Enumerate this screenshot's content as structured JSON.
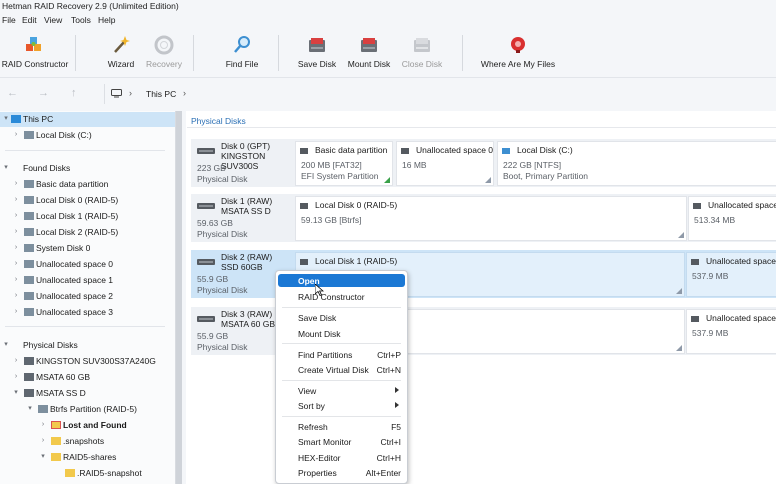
{
  "window": {
    "title": "Hetman RAID Recovery 2.9 (Unlimited Edition)"
  },
  "menu": [
    "File",
    "Edit",
    "View",
    "Tools",
    "Help"
  ],
  "toolbar": {
    "raid_constructor": "RAID Constructor",
    "wizard": "Wizard",
    "recovery": "Recovery",
    "find_file": "Find File",
    "save_disk": "Save Disk",
    "mount_disk": "Mount Disk",
    "close_disk": "Close Disk",
    "where_are_my_files": "Where Are My Files"
  },
  "breadcrumb": {
    "location": "This PC"
  },
  "tree": {
    "this_pc": "This PC",
    "local_disk_c": "Local Disk (C:)",
    "found_disks": "Found Disks",
    "found_items": [
      "Basic data partition",
      "Local Disk 0 (RAID-5)",
      "Local Disk 1 (RAID-5)",
      "Local Disk 2 (RAID-5)",
      "System Disk 0",
      "Unallocated space 0",
      "Unallocated space 1",
      "Unallocated space 2",
      "Unallocated space 3"
    ],
    "physical_disks": "Physical Disks",
    "physical_items": [
      "KINGSTON SUV300S37A240G",
      "MSATA 60 GB",
      "MSATA SS D"
    ],
    "btrfs": "Btrfs Partition (RAID-5)",
    "lost_and_found": "Lost and Found",
    "snapshots": ".snapshots",
    "raid5_shares": "RAID5-shares",
    "raid5_snapshot": ".RAID5-snapshot"
  },
  "main": {
    "title": "Physical Disks",
    "disks": [
      {
        "name": "Disk 0 (GPT)",
        "model": "KINGSTON SUV300S",
        "size": "223 GB",
        "type": "Physical Disk",
        "partitions": [
          {
            "name": "Basic data partition",
            "size": "200 MB [FAT32]",
            "desc": "EFI System Partition"
          },
          {
            "name": "Unallocated space 0",
            "size": "16 MB",
            "desc": ""
          },
          {
            "name": "Local Disk (C:)",
            "size": "222 GB [NTFS]",
            "desc": "Boot, Primary Partition"
          }
        ]
      },
      {
        "name": "Disk 1 (RAW)",
        "model": "MSATA SS D",
        "size": "59.63 GB",
        "type": "Physical Disk",
        "partitions": [
          {
            "name": "Local Disk 0 (RAID-5)",
            "size": "59.13 GB [Btrfs]",
            "desc": ""
          },
          {
            "name": "Unallocated space",
            "size": "513.34 MB",
            "desc": ""
          }
        ]
      },
      {
        "name": "Disk 2 (RAW)",
        "model": "SSD 60GB",
        "size": "55.9 GB",
        "type": "Physical Disk",
        "partitions": [
          {
            "name": "Local Disk 1 (RAID-5)",
            "size": "",
            "desc": ""
          },
          {
            "name": "Unallocated space",
            "size": "537.9 MB",
            "desc": ""
          }
        ]
      },
      {
        "name": "Disk 3 (RAW)",
        "model": "MSATA 60 GB",
        "size": "55.9 GB",
        "type": "Physical Disk",
        "partitions": [
          {
            "name": "",
            "size": "",
            "desc": ""
          },
          {
            "name": "Unallocated space",
            "size": "537.9 MB",
            "desc": ""
          }
        ]
      }
    ]
  },
  "context_menu": {
    "open": "Open",
    "raid_constructor": "RAID Constructor",
    "save_disk": "Save Disk",
    "mount_disk": "Mount Disk",
    "find_partitions": "Find Partitions",
    "find_partitions_key": "Ctrl+P",
    "create_virtual_disk": "Create Virtual Disk",
    "create_virtual_disk_key": "Ctrl+N",
    "view": "View",
    "sort_by": "Sort by",
    "refresh": "Refresh",
    "refresh_key": "F5",
    "smart_monitor": "Smart Monitor",
    "smart_monitor_key": "Ctrl+I",
    "hex_editor": "HEX-Editor",
    "hex_editor_key": "Ctrl+H",
    "properties": "Properties",
    "properties_key": "Alt+Enter"
  },
  "colors": {
    "accent": "#1b78d4",
    "selection": "#cde4f7",
    "link": "#2a6fb5"
  }
}
